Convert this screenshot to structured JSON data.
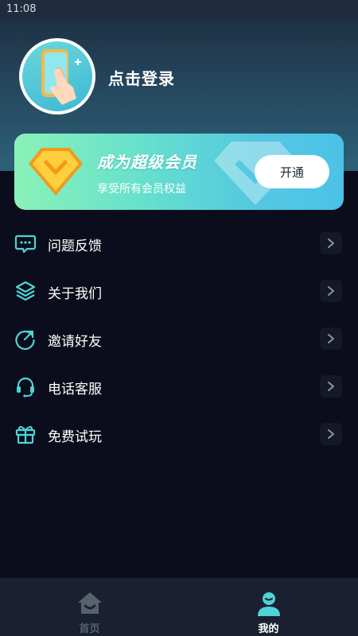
{
  "status_bar": {
    "time": "11:08"
  },
  "profile": {
    "login_label": "点击登录",
    "avatar_icon": "phone-tap-icon"
  },
  "vip_card": {
    "title": "成为超级会员",
    "subtitle": "享受所有会员权益",
    "button_label": "开通",
    "badge_icon": "vip-gem-icon"
  },
  "menu": {
    "items": [
      {
        "label": "问题反馈",
        "icon": "feedback-chat-icon"
      },
      {
        "label": "关于我们",
        "icon": "layers-icon"
      },
      {
        "label": "邀请好友",
        "icon": "share-arrow-icon"
      },
      {
        "label": "电话客服",
        "icon": "headset-icon"
      },
      {
        "label": "免费试玩",
        "icon": "gift-icon"
      }
    ]
  },
  "tabbar": {
    "tabs": [
      {
        "label": "首页",
        "icon": "home-icon",
        "active": false
      },
      {
        "label": "我的",
        "icon": "user-icon",
        "active": true
      }
    ]
  },
  "colors": {
    "background": "#0b0d1c",
    "accent_teal": "#4fd3d6",
    "tabbar": "#1b2030",
    "inactive_tab": "#56636e"
  }
}
